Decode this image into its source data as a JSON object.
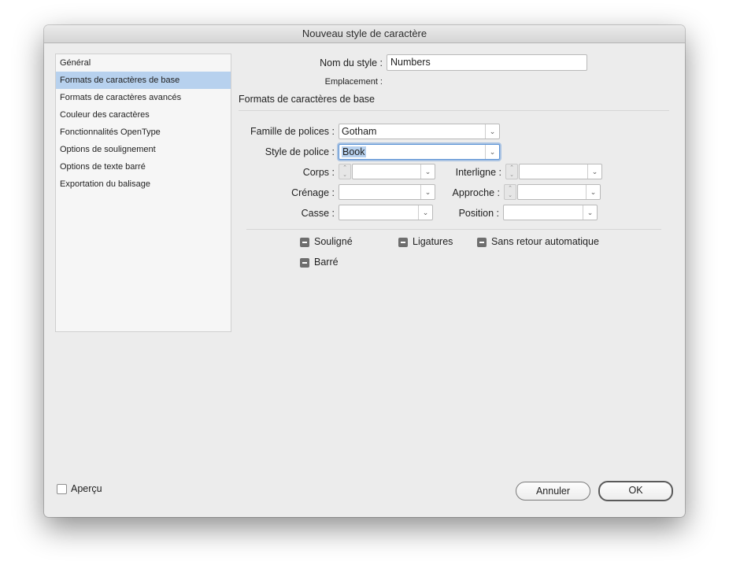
{
  "window": {
    "title": "Nouveau style de caractère"
  },
  "sidebar": {
    "items": [
      {
        "label": "Général"
      },
      {
        "label": "Formats de caractères de base",
        "selected": true
      },
      {
        "label": "Formats de caractères avancés"
      },
      {
        "label": "Couleur des caractères"
      },
      {
        "label": "Fonctionnalités OpenType"
      },
      {
        "label": "Options de soulignement"
      },
      {
        "label": "Options de texte barré"
      },
      {
        "label": "Exportation du balisage"
      }
    ]
  },
  "form": {
    "style_name_label": "Nom du style :",
    "style_name_value": "Numbers",
    "location_label": "Emplacement :",
    "section_title": "Formats de caractères de base",
    "font_family_label": "Famille de polices :",
    "font_family_value": "Gotham",
    "font_style_label": "Style de police :",
    "font_style_value": "Book",
    "size_label": "Corps :",
    "size_value": "",
    "leading_label": "Interligne :",
    "leading_value": "",
    "kerning_label": "Crénage :",
    "kerning_value": "",
    "tracking_label": "Approche :",
    "tracking_value": "",
    "case_label": "Casse :",
    "case_value": "",
    "position_label": "Position :",
    "position_value": ""
  },
  "checkboxes": {
    "underline": {
      "label": "Souligné",
      "state": "mixed"
    },
    "ligatures": {
      "label": "Ligatures",
      "state": "mixed"
    },
    "no_break": {
      "label": "Sans retour automatique",
      "state": "mixed"
    },
    "strikethrough": {
      "label": "Barré",
      "state": "mixed"
    }
  },
  "footer": {
    "preview_label": "Aperçu",
    "preview_checked": false,
    "cancel_label": "Annuler",
    "ok_label": "OK"
  },
  "colors": {
    "selection": "#b7d1ee",
    "focus": "#5b93d6"
  }
}
